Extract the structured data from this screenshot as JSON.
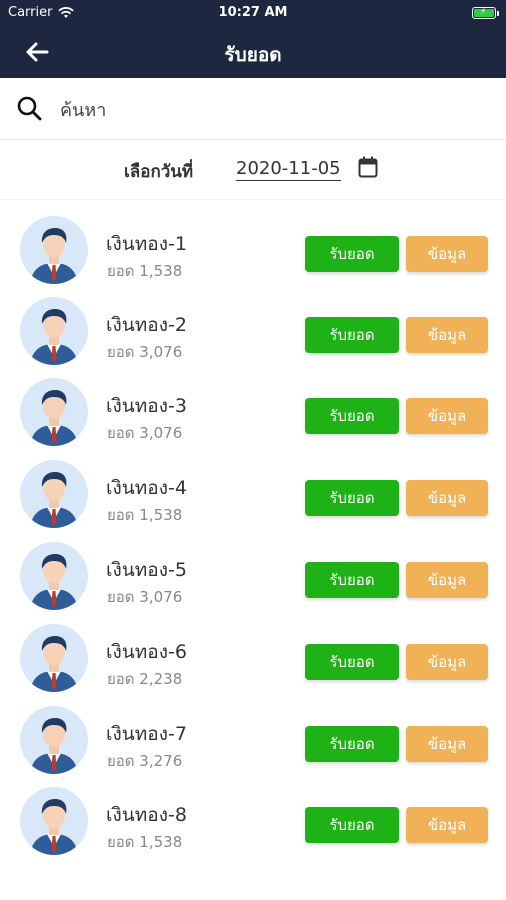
{
  "status_bar": {
    "carrier": "Carrier",
    "time": "10:27 AM"
  },
  "nav": {
    "title": "รับยอด",
    "back_icon": "arrow-left-icon"
  },
  "search": {
    "placeholder": "ค้นหา",
    "value": ""
  },
  "date_picker": {
    "label": "เลือกวันที่",
    "value": "2020-11-05"
  },
  "items": [
    {
      "name": "เงินทอง-1",
      "amount": "ยอด 1,538",
      "receive_label": "รับยอด",
      "info_label": "ข้อมูล"
    },
    {
      "name": "เงินทอง-2",
      "amount": "ยอด 3,076",
      "receive_label": "รับยอด",
      "info_label": "ข้อมูล"
    },
    {
      "name": "เงินทอง-3",
      "amount": "ยอด 3,076",
      "receive_label": "รับยอด",
      "info_label": "ข้อมูล"
    },
    {
      "name": "เงินทอง-4",
      "amount": "ยอด 1,538",
      "receive_label": "รับยอด",
      "info_label": "ข้อมูล"
    },
    {
      "name": "เงินทอง-5",
      "amount": "ยอด 3,076",
      "receive_label": "รับยอด",
      "info_label": "ข้อมูล"
    },
    {
      "name": "เงินทอง-6",
      "amount": "ยอด 2,238",
      "receive_label": "รับยอด",
      "info_label": "ข้อมูล"
    },
    {
      "name": "เงินทอง-7",
      "amount": "ยอด 3,276",
      "receive_label": "รับยอด",
      "info_label": "ข้อมูล"
    },
    {
      "name": "เงินทอง-8",
      "amount": "ยอด 1,538",
      "receive_label": "รับยอด",
      "info_label": "ข้อมูล"
    }
  ],
  "colors": {
    "header": "#1d2840",
    "receive_button": "#1fb217",
    "info_button": "#f1b257",
    "avatar_bg": "#d8e8f9"
  }
}
